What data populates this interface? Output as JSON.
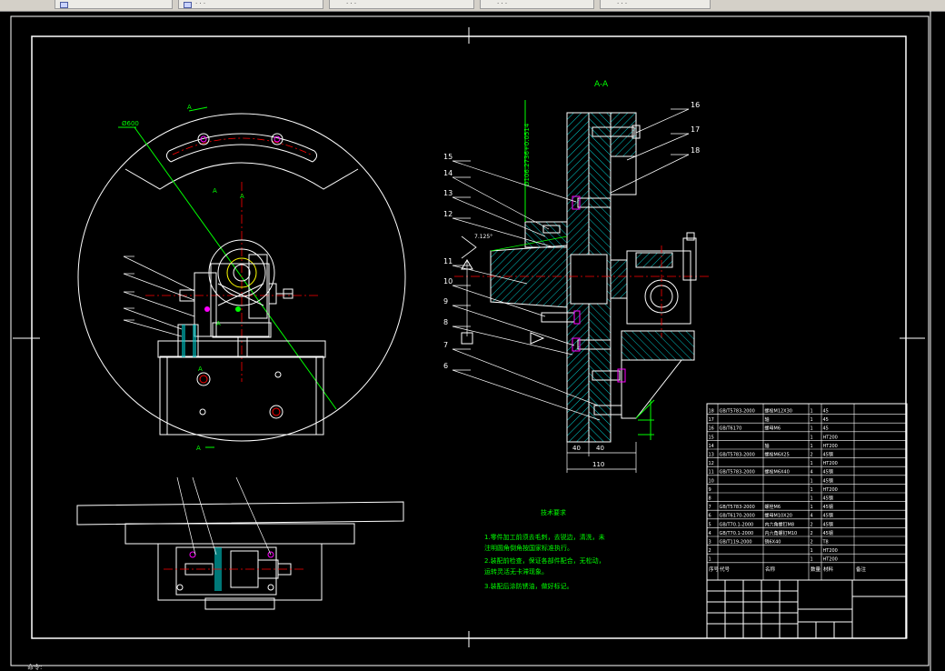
{
  "tabs": [
    {
      "label": "",
      "active": true
    },
    {
      "label": "· ·  ·",
      "active": false
    },
    {
      "label": "· ·  ·",
      "active": false
    },
    {
      "label": "· ·  ·",
      "active": false
    },
    {
      "label": "· ·  ·",
      "active": false
    }
  ],
  "drawing": {
    "view_label": "A-A",
    "dim_110": "110",
    "dim_40_left": "40",
    "dim_40_right": "40",
    "diam_label": "Ø600",
    "callouts": [
      "16",
      "17",
      "18",
      "15",
      "14",
      "13",
      "12",
      "11",
      "10",
      "9",
      "8",
      "7",
      "6"
    ],
    "section_marks": [
      "A",
      "A",
      "A",
      "A",
      "A",
      "A"
    ]
  },
  "technical_notes": {
    "title": "技术要求",
    "lines": [
      "1.零件加工前须去毛刺，去锐边，清洗，未",
      "注明圆角倒角按国家标准执行。",
      "2.装配前检查，保证各部件配合，无松动，",
      "运转灵活无卡滞现象。",
      "3.装配后涂防锈油，做好标记。"
    ]
  },
  "parts_table": {
    "rows": [
      [
        "18",
        "GB/T5783-2000",
        "螺栓M12X30",
        "1",
        "45"
      ],
      [
        "17",
        "",
        "轴",
        "1",
        "45"
      ],
      [
        "16",
        "GB/T6170",
        "螺母M6",
        "1",
        "45"
      ],
      [
        "15",
        "",
        "",
        "1",
        "HT200"
      ],
      [
        "14",
        "",
        "轴",
        "1",
        "HT200"
      ],
      [
        "13",
        "GB/T5783-2000",
        "螺栓M6X25",
        "2",
        "45钢"
      ],
      [
        "12",
        "",
        "",
        "1",
        "HT200"
      ],
      [
        "11",
        "GB/T5783-2000",
        "螺栓M6X40",
        "4",
        "45钢"
      ],
      [
        "10",
        "",
        "",
        "1",
        "45钢"
      ],
      [
        "9",
        "",
        "",
        "1",
        "HT200"
      ],
      [
        "8",
        "",
        "",
        "1",
        "45钢"
      ],
      [
        "7",
        "GB/T5783-2000",
        "螺栓M6",
        "1",
        "45钢"
      ],
      [
        "6",
        "GB/T6170-2000",
        "螺母M10X20",
        "4",
        "45钢"
      ],
      [
        "5",
        "GB/T70.1-2000",
        "内六角螺钉M8",
        "2",
        "45钢"
      ],
      [
        "4",
        "GB/T70.1-2000",
        "内六角螺钉M10",
        "2",
        "45钢"
      ],
      [
        "3",
        "GB/T119-2000",
        "销6X40",
        "2",
        "T8"
      ],
      [
        "2",
        "",
        "",
        "1",
        "HT200"
      ],
      [
        "1",
        "",
        "",
        "1",
        "HT200"
      ]
    ],
    "header": [
      "序号",
      "代号",
      "名称",
      "数量",
      "材料",
      "备注"
    ]
  },
  "command_line": "命令:",
  "colors": {
    "line_white": "#ffffff",
    "line_green": "#00ff00",
    "line_red": "#ff0000",
    "line_cyan": "#00ffff",
    "line_magenta": "#ff00ff",
    "hatch": "#00c8c8"
  }
}
